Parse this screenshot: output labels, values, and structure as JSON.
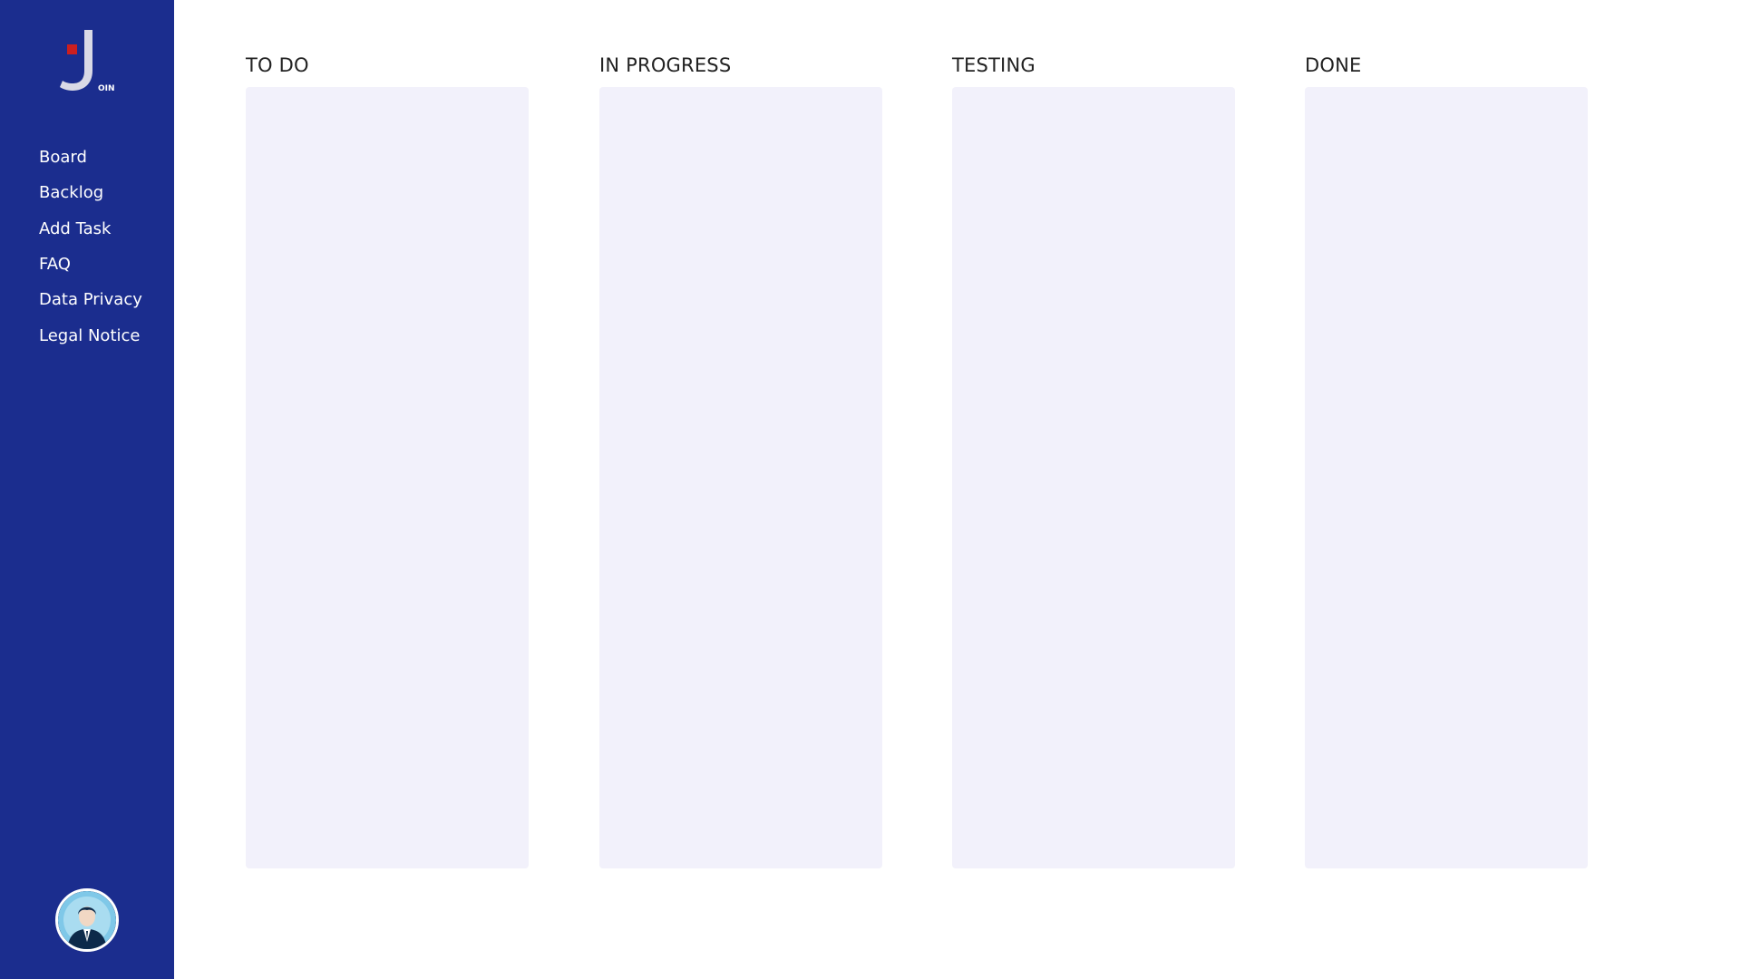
{
  "sidebar": {
    "logo": {
      "letter": "J",
      "suffix": "OIN",
      "accent_color": "#cc1f1f",
      "letter_color": "#d9d9e6"
    },
    "nav": [
      {
        "label": "Board",
        "icon": "none"
      },
      {
        "label": "Backlog",
        "icon": "none"
      },
      {
        "label": "Add Task",
        "icon": "none"
      },
      {
        "label": "FAQ",
        "icon": "none"
      },
      {
        "label": "Data Privacy",
        "icon": "none"
      },
      {
        "label": "Legal Notice",
        "icon": "none"
      }
    ],
    "avatar": {
      "icon": "user-avatar-icon"
    },
    "background_color": "#1b2d8e"
  },
  "board": {
    "columns": [
      {
        "title": "TO DO",
        "tasks": []
      },
      {
        "title": "IN PROGRESS",
        "tasks": []
      },
      {
        "title": "TESTING",
        "tasks": []
      },
      {
        "title": "DONE",
        "tasks": []
      }
    ],
    "column_background_color": "#f2f1fb"
  }
}
